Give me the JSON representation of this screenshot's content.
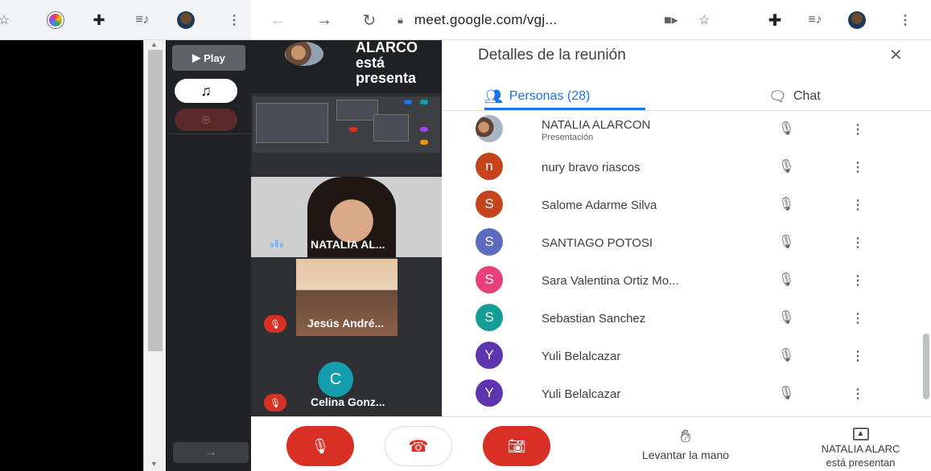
{
  "left_window": {
    "toolbar_icons": [
      "star-icon",
      "color-wheel-icon",
      "extensions-icon",
      "media-control-icon",
      "profile-avatar",
      "more-vert-icon"
    ],
    "play_label": "Play",
    "music_icon": "music-note-icon",
    "zoom_icon": "zoom-in-icon",
    "next_icon": "arrow-right-icon"
  },
  "browser": {
    "url": "meet.google.com/vgj...",
    "back_icon": "back-arrow-icon",
    "forward_icon": "forward-arrow-icon",
    "reload_icon": "reload-icon"
  },
  "meet": {
    "presenter_text": [
      "ALARCO",
      "está",
      "presenta"
    ],
    "tiles": [
      {
        "name": "NATALIA AL...",
        "speaking": true
      },
      {
        "name": "Jesús André...",
        "muted": true
      },
      {
        "name": "Celina Gonz...",
        "muted": true,
        "initial": "C"
      }
    ]
  },
  "panel": {
    "title": "Detalles de la reunión",
    "close_icon": "close-icon",
    "tab_people": "Personas (28)",
    "tab_chat": "Chat",
    "participants": [
      {
        "name": "NATALIA ALARCON",
        "subtitle": "Presentación",
        "initial": "",
        "color": "",
        "photo": true
      },
      {
        "name": "nury bravo riascos",
        "initial": "n",
        "color": "#c5441c"
      },
      {
        "name": "Salome Adarme Silva",
        "initial": "S",
        "color": "#c5441c"
      },
      {
        "name": "SANTIAGO POTOSI",
        "initial": "S",
        "color": "#5c6bc0"
      },
      {
        "name": "Sara Valentina Ortiz Mo...",
        "initial": "S",
        "color": "#e8407a"
      },
      {
        "name": "Sebastian Sanchez",
        "initial": "S",
        "color": "#139d95"
      },
      {
        "name": "Yuli Belalcazar",
        "initial": "Y",
        "color": "#5e35b1"
      },
      {
        "name": "Yuli Belalcazar",
        "initial": "Y",
        "color": "#5e35b1"
      }
    ]
  },
  "bottom": {
    "raise_hand": "Levantar la mano",
    "presenting_line1": "NATALIA ALARC",
    "presenting_line2": "está presentan"
  },
  "colors": {
    "meet_red": "#d93025",
    "meet_blue": "#1a73e8",
    "tile_bg": "#3c4043"
  }
}
